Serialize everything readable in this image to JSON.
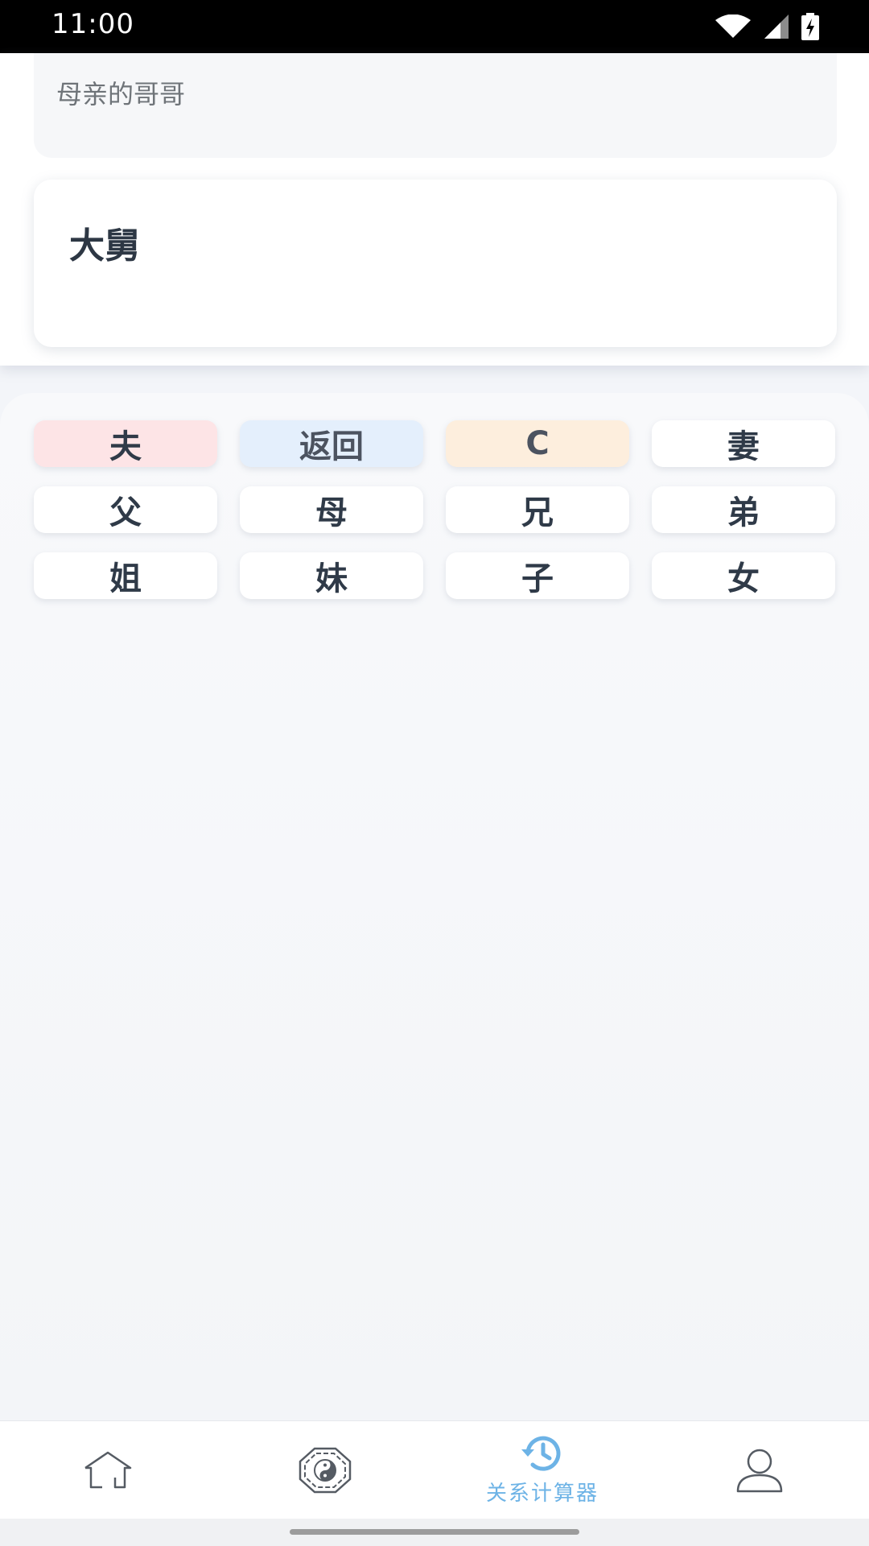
{
  "status_bar": {
    "time": "11:00"
  },
  "input": {
    "text": "母亲的哥哥"
  },
  "result": {
    "text": "大舅"
  },
  "keypad": {
    "rows": [
      [
        {
          "label": "夫",
          "name": "key-husband",
          "style": "red"
        },
        {
          "label": "返回",
          "name": "key-back",
          "style": "blue"
        },
        {
          "label": "C",
          "name": "key-clear",
          "style": "orange"
        },
        {
          "label": "妻",
          "name": "key-wife",
          "style": "plain"
        }
      ],
      [
        {
          "label": "父",
          "name": "key-father",
          "style": "plain"
        },
        {
          "label": "母",
          "name": "key-mother",
          "style": "plain"
        },
        {
          "label": "兄",
          "name": "key-elder-brother",
          "style": "plain"
        },
        {
          "label": "弟",
          "name": "key-younger-brother",
          "style": "plain"
        }
      ],
      [
        {
          "label": "姐",
          "name": "key-elder-sister",
          "style": "plain"
        },
        {
          "label": "妹",
          "name": "key-younger-sister",
          "style": "plain"
        },
        {
          "label": "子",
          "name": "key-son",
          "style": "plain"
        },
        {
          "label": "女",
          "name": "key-daughter",
          "style": "plain"
        }
      ]
    ]
  },
  "bottom_nav": {
    "items": [
      {
        "icon": "home-icon",
        "label": ""
      },
      {
        "icon": "yin-yang-bagua-icon",
        "label": ""
      },
      {
        "icon": "history-clock-icon",
        "label": "关系计算器",
        "active": true
      },
      {
        "icon": "user-icon",
        "label": ""
      }
    ],
    "active_color": "#6db3e6",
    "inactive_color": "#555b63"
  }
}
